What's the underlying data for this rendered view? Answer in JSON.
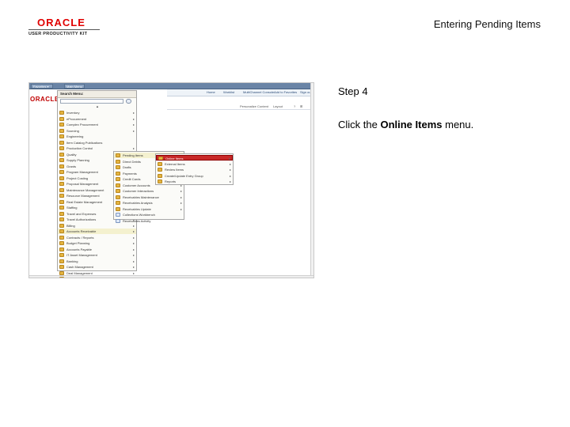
{
  "header": {
    "logo_oracle": "ORACLE",
    "logo_tagline": "USER PRODUCTIVITY KIT",
    "doc_title": "Entering Pending Items"
  },
  "step": {
    "number_label": "Step 4",
    "instruction_prefix": "Click the ",
    "instruction_target": "Online Items",
    "instruction_suffix": " menu."
  },
  "screenshot": {
    "tabs": [
      "Favorites ▾",
      "Main Menu ▾"
    ],
    "brand": "ORACLE",
    "topnav": [
      "Home",
      "Worklist",
      "MultiChannel Console",
      "Add to Favorites",
      "Sign out"
    ],
    "personalize": [
      "Personalize Content",
      "Layout",
      "?",
      "⊞"
    ],
    "search_menu_title": "Search Menu:",
    "collapse_glyph": "▲",
    "main_menu": [
      {
        "label": "Inventory",
        "arrow": "▸"
      },
      {
        "label": "eProcurement",
        "arrow": "▸"
      },
      {
        "label": "Complex Procurement",
        "arrow": "▸"
      },
      {
        "label": "Sourcing",
        "arrow": "▸"
      },
      {
        "label": "Engineering",
        "arrow": ""
      },
      {
        "label": "Item Catalog Publications",
        "arrow": ""
      },
      {
        "label": "Production Control",
        "arrow": "▸"
      },
      {
        "label": "Quality",
        "arrow": ""
      },
      {
        "label": "Supply Planning",
        "arrow": "▸"
      },
      {
        "label": "Grants",
        "arrow": "▸"
      },
      {
        "label": "Program Management",
        "arrow": "▸"
      },
      {
        "label": "Project Costing",
        "arrow": "▸"
      },
      {
        "label": "Proposal Management",
        "arrow": "▸"
      },
      {
        "label": "Maintenance Management",
        "arrow": "▸"
      },
      {
        "label": "Resource Management",
        "arrow": "▸"
      },
      {
        "label": "Real Estate Management",
        "arrow": "▸"
      },
      {
        "label": "Staffing",
        "arrow": "▸"
      },
      {
        "label": "Travel and Expenses",
        "arrow": "▸"
      },
      {
        "label": "Travel Authorizations",
        "arrow": "▸"
      },
      {
        "label": "Billing",
        "arrow": "▸"
      },
      {
        "label": "Accounts Receivable",
        "arrow": "▸"
      },
      {
        "label": "Contracts / Reports",
        "arrow": "▸"
      },
      {
        "label": "Budget Planning",
        "arrow": "▸"
      },
      {
        "label": "Accounts Payable",
        "arrow": "▸"
      },
      {
        "label": "IT Asset Management",
        "arrow": "▸"
      },
      {
        "label": "Banking",
        "arrow": "▸"
      },
      {
        "label": "Cash Management",
        "arrow": "▸"
      },
      {
        "label": "Deal Management",
        "arrow": "▸"
      },
      {
        "label": "Risk Management",
        "arrow": "▸"
      }
    ],
    "submenu_ar": [
      {
        "label": "Pending Items",
        "arrow": "▸",
        "icon": "folder"
      },
      {
        "label": "Direct Debits",
        "arrow": "▸",
        "icon": "folder"
      },
      {
        "label": "Drafts",
        "arrow": "▸",
        "icon": "folder"
      },
      {
        "label": "Payments",
        "arrow": "▸",
        "icon": "folder"
      },
      {
        "label": "Credit Cards",
        "arrow": "▸",
        "icon": "folder"
      },
      {
        "label": "Customer Accounts",
        "arrow": "▸",
        "icon": "folder"
      },
      {
        "label": "Customer Interactions",
        "arrow": "▸",
        "icon": "folder"
      },
      {
        "label": "Receivables Maintenance",
        "arrow": "▸",
        "icon": "folder"
      },
      {
        "label": "Receivables Analysis",
        "arrow": "▸",
        "icon": "folder"
      },
      {
        "label": "Receivables Update",
        "arrow": "▸",
        "icon": "folder"
      },
      {
        "label": "Collections Workbench",
        "arrow": "",
        "icon": "doc"
      },
      {
        "label": "Receivables Activity",
        "arrow": "",
        "icon": "doc"
      }
    ],
    "submenu_pending": [
      {
        "label": "Online Items",
        "arrow": "▸",
        "selected": true
      },
      {
        "label": "External Items",
        "arrow": "▸",
        "selected": false
      },
      {
        "label": "Review Items",
        "arrow": "▸",
        "selected": false
      },
      {
        "label": "Create/Update Entry Group",
        "arrow": "▸",
        "selected": false
      },
      {
        "label": "Reports",
        "arrow": "▸",
        "selected": false
      }
    ]
  }
}
